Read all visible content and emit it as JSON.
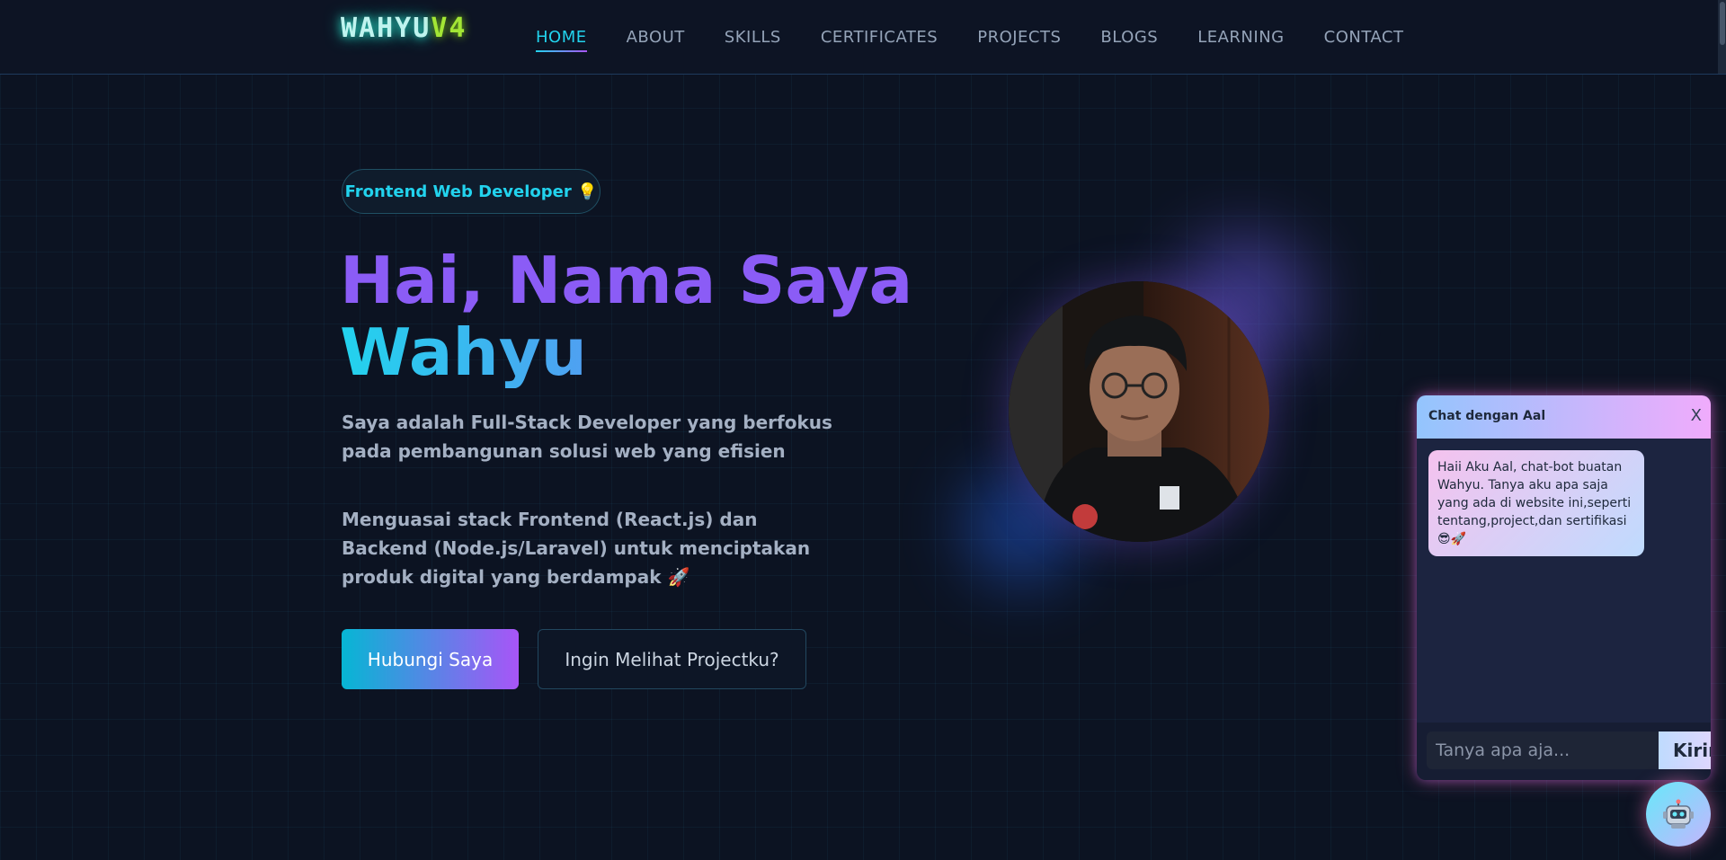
{
  "brand": {
    "part1": "WAHYU",
    "part2": "V4"
  },
  "nav": {
    "items": [
      {
        "label": "HOME",
        "active": true
      },
      {
        "label": "ABOUT"
      },
      {
        "label": "SKILLS"
      },
      {
        "label": "CERTIFICATES"
      },
      {
        "label": "PROJECTS"
      },
      {
        "label": "BLOGS"
      },
      {
        "label": "LEARNING"
      },
      {
        "label": "CONTACT"
      }
    ]
  },
  "hero": {
    "badge": "Frontend Web Developer 💡",
    "title_line1": "Hai, Nama Saya",
    "title_line2": "Wahyu",
    "description1": "Saya adalah Full-Stack Developer yang berfokus pada pembangunan solusi web yang efisien",
    "description2": "Menguasai stack Frontend (React.js) dan Backend (Node.js/Laravel) untuk menciptakan produk digital yang berdampak 🚀",
    "primary_button": "Hubungi Saya",
    "secondary_button": "Ingin Melihat Projectku?"
  },
  "profile": {
    "icon": "profile-photo"
  },
  "chat": {
    "title": "Chat dengan Aal",
    "close_label": "X",
    "bot_message": "Haii Aku Aal, chat-bot buatan Wahyu. Tanya aku apa saja yang ada di website ini,seperti tentang,project,dan sertifikasi 😎🚀",
    "input_placeholder": "Tanya apa aja...",
    "send_label": "Kirim"
  },
  "colors": {
    "background": "#0c1322",
    "accent_cyan": "#22d3ee",
    "accent_purple": "#8b5cf6",
    "chat_gradient_start": "#93c5fd",
    "chat_gradient_end": "#f0abfc"
  }
}
